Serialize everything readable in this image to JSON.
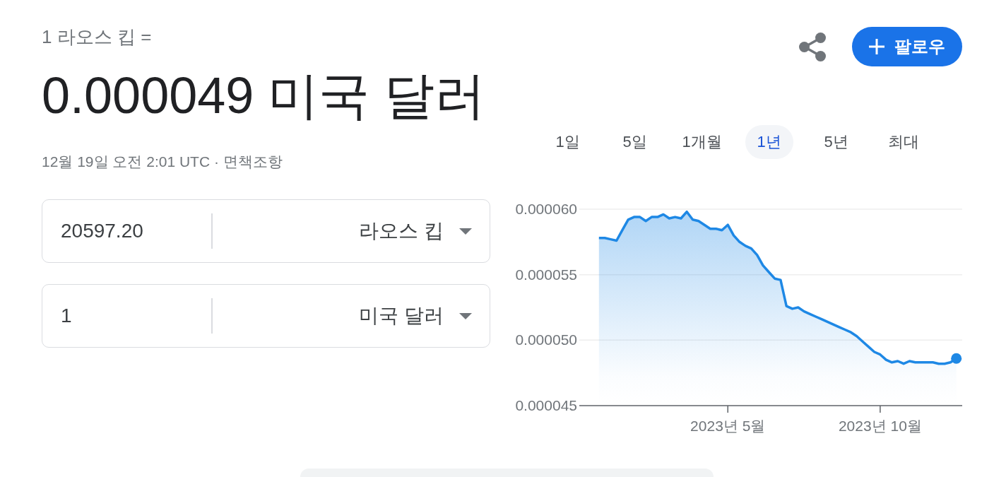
{
  "header": {
    "title": "1 라오스 킵 =",
    "result": "0.000049 미국 달러",
    "timestamp": "12월 19일 오전 2:01 UTC",
    "separator": "·",
    "disclaimer_link": "면책조항"
  },
  "actions": {
    "follow_button": {
      "label": "팔로우"
    }
  },
  "converter": [
    {
      "amount": "20597.20",
      "currency": "라오스 킵"
    },
    {
      "amount": "1",
      "currency": "미국 달러"
    }
  ],
  "range_tabs": [
    {
      "label": "1일",
      "selected": false
    },
    {
      "label": "5일",
      "selected": false
    },
    {
      "label": "1개월",
      "selected": false
    },
    {
      "label": "1년",
      "selected": true
    },
    {
      "label": "5년",
      "selected": false
    },
    {
      "label": "최대",
      "selected": false
    }
  ],
  "chart": {
    "chart_data": {
      "type": "area",
      "categories": [
        null,
        null,
        null,
        null,
        null,
        null,
        null,
        null,
        null,
        null,
        null,
        null,
        null,
        null,
        null,
        null,
        null,
        null,
        null,
        null,
        null,
        null,
        "2023년 5월",
        null,
        null,
        null,
        null,
        null,
        null,
        null,
        null,
        null,
        null,
        null,
        null,
        null,
        null,
        null,
        null,
        null,
        null,
        null,
        null,
        null,
        null,
        null,
        null,
        null,
        "2023년 10월",
        null,
        null,
        null,
        null,
        null,
        null,
        null,
        null,
        null,
        null,
        null,
        null,
        null
      ],
      "values": [
        5.78e-05,
        5.78e-05,
        5.77e-05,
        5.76e-05,
        5.84e-05,
        5.92e-05,
        5.94e-05,
        5.94e-05,
        5.91e-05,
        5.94e-05,
        5.94e-05,
        5.96e-05,
        5.93e-05,
        5.94e-05,
        5.93e-05,
        5.98e-05,
        5.92e-05,
        5.91e-05,
        5.88e-05,
        5.85e-05,
        5.85e-05,
        5.84e-05,
        5.88e-05,
        5.8e-05,
        5.75e-05,
        5.72e-05,
        5.7e-05,
        5.65e-05,
        5.57e-05,
        5.52e-05,
        5.47e-05,
        5.46e-05,
        5.26e-05,
        5.24e-05,
        5.25e-05,
        5.22e-05,
        5.2e-05,
        5.18e-05,
        5.16e-05,
        5.14e-05,
        5.12e-05,
        5.1e-05,
        5.08e-05,
        5.06e-05,
        5.03e-05,
        4.99e-05,
        4.95e-05,
        4.91e-05,
        4.89e-05,
        4.85e-05,
        4.83e-05,
        4.84e-05,
        4.82e-05,
        4.84e-05,
        4.83e-05,
        4.83e-05,
        4.83e-05,
        4.83e-05,
        4.82e-05,
        4.82e-05,
        4.83e-05,
        4.86e-05
      ],
      "ylim": [
        4.5e-05,
        6e-05
      ],
      "yticks": [
        {
          "value": 6e-05,
          "label": "0.000060"
        },
        {
          "value": 5.5e-05,
          "label": "0.000055"
        },
        {
          "value": 5e-05,
          "label": "0.000050"
        },
        {
          "value": 4.5e-05,
          "label": "0.000045"
        }
      ]
    }
  }
}
